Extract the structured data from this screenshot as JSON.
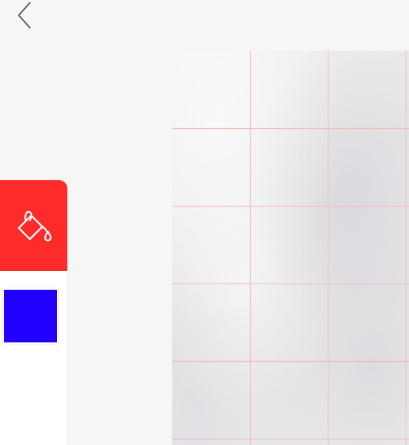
{
  "nav": {
    "back_icon": "chevron-left-icon"
  },
  "toolbar": {
    "active_tool_icon": "paint-bucket-icon",
    "active_tool_color": "#ff2a2a",
    "tool_icon_color": "#ffffff"
  },
  "palette": {
    "selected_color": "#2200ff"
  },
  "canvas": {
    "grid_line_color": "#f2b9b9",
    "paper_color": "#eeeef0"
  },
  "colors": {
    "page_background": "#f6f6f6",
    "panel_background": "#ffffff",
    "back_icon_color": "#555555"
  }
}
